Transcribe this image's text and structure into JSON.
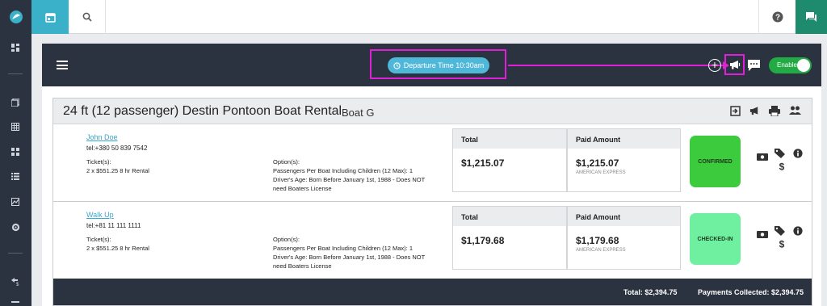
{
  "header": {
    "departure_label": "Departure Time 10:30am",
    "toggle_label": "Enable"
  },
  "booking": {
    "title": "24 ft (12 passenger) Destin Pontoon Boat Rental",
    "subtitle": "Boat G"
  },
  "columns": {
    "total": "Total",
    "paid": "Paid Amount"
  },
  "reservations": [
    {
      "name": "John Doe",
      "tel": "tel:+380 50 839 7542",
      "tickets_label": "Ticket(s):",
      "tickets": "2 x $551.25 8 hr Rental",
      "options_label": "Option(s):",
      "options_line1": "Passengers Per Boat Including Children (12 Max): 1",
      "options_line2": "Driver's Age: Born Before January 1st, 1988 - Does NOT",
      "options_line3": "need Boaters License",
      "total": "$1,215.07",
      "paid": "$1,215.07",
      "paid_method": "AMERICAN EXPRESS",
      "status": "CONFIRMED"
    },
    {
      "name": "Walk Up",
      "tel": "tel:+81 11 111 1111",
      "tickets_label": "Ticket(s):",
      "tickets": "2 x $551.25 8 hr Rental",
      "options_label": "Option(s):",
      "options_line1": "Passengers Per Boat Including Children (12 Max): 1",
      "options_line2": "Driver's Age: Born Before January 1st, 1988 - Does NOT",
      "options_line3": "need Boaters License",
      "total": "$1,179.68",
      "paid": "$1,179.68",
      "paid_method": "AMERICAN EXPRESS",
      "status": "CHECKED-IN"
    }
  ],
  "footer": {
    "total": "Total: $2,394.75",
    "payments": "Payments Collected: $2,394.75"
  },
  "colors": {
    "sidebar": "#2b3240",
    "accent_teal": "#3ab0c9",
    "chat_green": "#1f8b6e",
    "highlight": "#e020d8",
    "confirmed": "#3ccb3c",
    "checked_in": "#6ef0a0",
    "toggle": "#22aa44"
  }
}
